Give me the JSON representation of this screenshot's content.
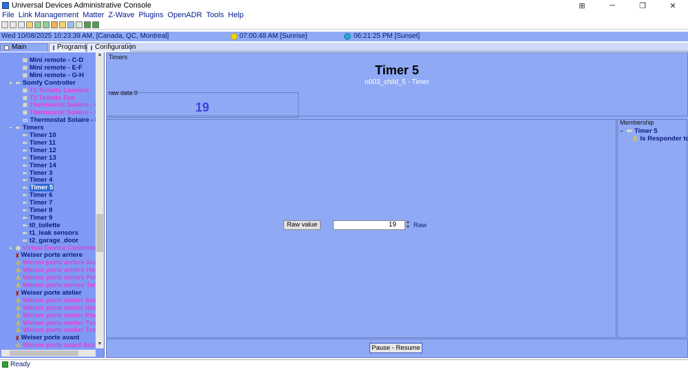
{
  "window": {
    "title": "Universal Devices Administrative Console",
    "controls": [
      "⊞",
      "─",
      "❐",
      "✕"
    ]
  },
  "menu": [
    "File",
    "Link Management",
    "Matter",
    "Z-Wave",
    "Plugins",
    "OpenADR",
    "Tools",
    "Help"
  ],
  "infobar": {
    "datetime": "Wed 10/08/2025 10:23:39 AM,  [Canada, QC, Montreal]",
    "sunrise": "07:00:48 AM [Sunrise]",
    "sunset": "06:21:25 PM [Sunset]"
  },
  "tabs": [
    {
      "label": "Main",
      "active": true
    },
    {
      "label": "Programs",
      "active": false
    },
    {
      "label": "Configuration",
      "active": false
    }
  ],
  "tree": [
    {
      "label": "Mini remote - C-D",
      "color": "navy",
      "indent": 1,
      "icon": "grid"
    },
    {
      "label": "Mini remote - E-F",
      "color": "navy",
      "indent": 1,
      "icon": "grid"
    },
    {
      "label": "Mini remote - G-H",
      "color": "navy",
      "indent": 1,
      "icon": "grid"
    },
    {
      "label": "Somfy Controller",
      "color": "navy",
      "indent": 0,
      "icon": "arrow",
      "expander": "+"
    },
    {
      "label": "T1 Toilette Lumiere",
      "color": "pink",
      "indent": 1,
      "icon": "grid"
    },
    {
      "label": "T2 Toilette Fan",
      "color": "pink",
      "indent": 1,
      "icon": "grid"
    },
    {
      "label": "Thermostat Solaire - Coo",
      "color": "pink",
      "indent": 1,
      "icon": "grid"
    },
    {
      "label": "Thermostat Solaire - Hea",
      "color": "pink",
      "indent": 1,
      "icon": "grid"
    },
    {
      "label": "Thermostat Solaire - Mai",
      "color": "navy",
      "indent": 1,
      "icon": "box"
    },
    {
      "label": "Timers",
      "color": "navy",
      "indent": 0,
      "icon": "arrow",
      "expander": "−"
    },
    {
      "label": "Timer 10",
      "color": "navy",
      "indent": 1,
      "icon": "arrow"
    },
    {
      "label": "Timer 11",
      "color": "navy",
      "indent": 1,
      "icon": "arrow"
    },
    {
      "label": "Timer 12",
      "color": "navy",
      "indent": 1,
      "icon": "arrow"
    },
    {
      "label": "Timer 13",
      "color": "navy",
      "indent": 1,
      "icon": "arrow"
    },
    {
      "label": "Timer 14",
      "color": "navy",
      "indent": 1,
      "icon": "arrow"
    },
    {
      "label": "Timer 3",
      "color": "navy",
      "indent": 1,
      "icon": "arrow"
    },
    {
      "label": "Timer 4",
      "color": "navy",
      "indent": 1,
      "icon": "arrow"
    },
    {
      "label": "Timer 5",
      "color": "navy",
      "indent": 1,
      "icon": "arrow",
      "selected": true
    },
    {
      "label": "Timer 6",
      "color": "navy",
      "indent": 1,
      "icon": "arrow"
    },
    {
      "label": "Timer 7",
      "color": "navy",
      "indent": 1,
      "icon": "arrow"
    },
    {
      "label": "Timer 8",
      "color": "navy",
      "indent": 1,
      "icon": "arrow"
    },
    {
      "label": "Timer 9",
      "color": "navy",
      "indent": 1,
      "icon": "arrow"
    },
    {
      "label": "t0_toilette",
      "color": "navy",
      "indent": 1,
      "icon": "arrow"
    },
    {
      "label": "t1_leak sensors",
      "color": "navy",
      "indent": 1,
      "icon": "arrow"
    },
    {
      "label": "t2_garage_door",
      "color": "navy",
      "indent": 1,
      "icon": "arrow"
    },
    {
      "label": "Virtual Device Controller",
      "color": "pink",
      "indent": 0,
      "icon": "grid",
      "expander": "+"
    },
    {
      "label": "Weiser porte arriere",
      "color": "navy",
      "indent": 0,
      "icon": "door"
    },
    {
      "label": "Weiser porte arriere Acce",
      "color": "pink",
      "indent": 0,
      "icon": "warn"
    },
    {
      "label": "Weiser porte arriere Hom",
      "color": "pink",
      "indent": 0,
      "icon": "warn"
    },
    {
      "label": "Weiser porte arriere Pow",
      "color": "pink",
      "indent": 0,
      "icon": "warn"
    },
    {
      "label": "Weiser porte arriere Tam",
      "color": "pink",
      "indent": 0,
      "icon": "warn"
    },
    {
      "label": "Weiser porte atelier",
      "color": "navy",
      "indent": 0,
      "icon": "door"
    },
    {
      "label": "Weiser porte atelier Acce",
      "color": "pink",
      "indent": 0,
      "icon": "warn"
    },
    {
      "label": "Weiser porte atelier Hom",
      "color": "pink",
      "indent": 0,
      "icon": "warn"
    },
    {
      "label": "Weiser porte atelier Pow",
      "color": "pink",
      "indent": 0,
      "icon": "warn"
    },
    {
      "label": "Weiser porte atelier Tam",
      "color": "pink",
      "indent": 0,
      "icon": "warn"
    },
    {
      "label": "Weiser porte atelier Tam",
      "color": "pink",
      "indent": 0,
      "icon": "warn"
    },
    {
      "label": "Weiser porte avant",
      "color": "navy",
      "indent": 0,
      "icon": "door"
    },
    {
      "label": "Weiser porte avant Acce",
      "color": "pink",
      "indent": 0,
      "icon": "warn"
    }
  ],
  "main": {
    "section_label": "Timers",
    "node_name": "Timer 5",
    "node_address": "n003_child_5 - Timer",
    "rawdata_label": "raw data 0",
    "rawdata_value": "19",
    "membership_label": "Membership",
    "membership_group": "Timer 5",
    "membership_role": "Is Responder to",
    "raw_button": "Raw value",
    "raw_input_value": "19",
    "raw_unit": "Raw",
    "pause_button": "Pause - Resume"
  },
  "status": "Ready"
}
